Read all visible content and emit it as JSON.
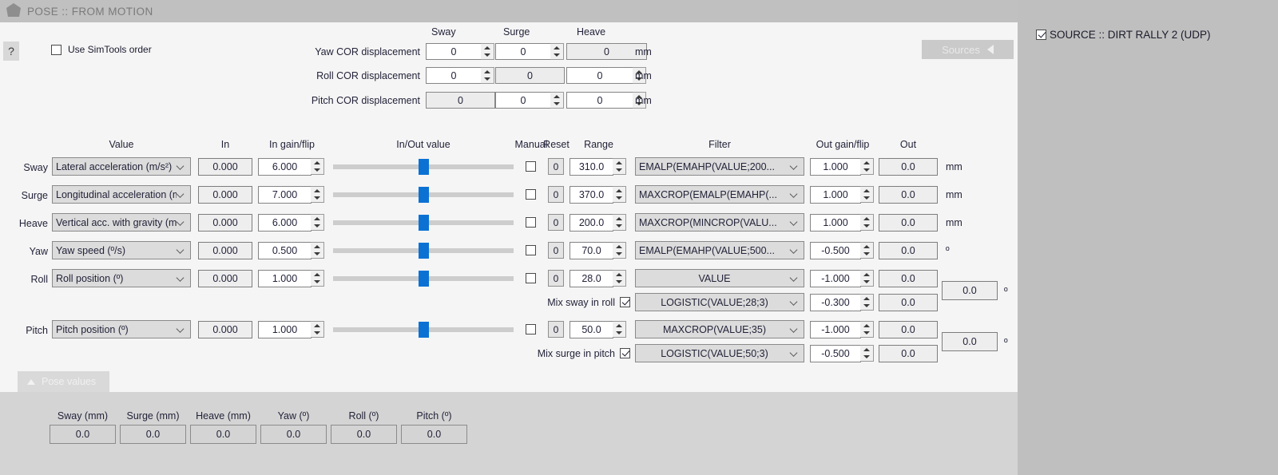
{
  "window": {
    "title": "POSE :: FROM MOTION",
    "icon": "pose-hex-icon",
    "scroll_up_arrow": "scroll-up-arrow"
  },
  "help_button": {
    "label": "?"
  },
  "options": {
    "simtools_order": {
      "label": "Use SimTools order",
      "checked": false
    }
  },
  "sources_button": {
    "label": "Sources",
    "arrow": "left-triangle"
  },
  "source_panel": {
    "checkbox_label": "SOURCE :: DIRT RALLY 2 (UDP)",
    "checked": true
  },
  "cor": {
    "headers": [
      "Sway",
      "Surge",
      "Heave"
    ],
    "unit": "mm",
    "rows": [
      {
        "label": "Yaw COR displacement",
        "sway": {
          "value": "0",
          "spinner": true,
          "disabled": false
        },
        "surge": {
          "value": "0",
          "spinner": true,
          "disabled": false
        },
        "heave": {
          "value": "0",
          "spinner": false,
          "disabled": true
        }
      },
      {
        "label": "Roll COR displacement",
        "sway": {
          "value": "0",
          "spinner": true,
          "disabled": false
        },
        "surge": {
          "value": "0",
          "spinner": false,
          "disabled": true
        },
        "heave": {
          "value": "0",
          "spinner": true,
          "disabled": false
        }
      },
      {
        "label": "Pitch COR displacement",
        "sway": {
          "value": "0",
          "spinner": false,
          "disabled": true
        },
        "surge": {
          "value": "0",
          "spinner": true,
          "disabled": false
        },
        "heave": {
          "value": "0",
          "spinner": true,
          "disabled": false
        }
      }
    ]
  },
  "grid": {
    "headers": {
      "value": "Value",
      "in": "In",
      "in_gain": "In gain/flip",
      "inout": "In/Out value",
      "manual": "Manual",
      "reset": "Reset",
      "range": "Range",
      "filter": "Filter",
      "out_gain": "Out gain/flip",
      "out": "Out"
    },
    "rows": [
      {
        "axis": "Sway",
        "value": "Lateral acceleration (m/s²)",
        "in": "0.000",
        "in_gain": "6.000",
        "slider_pct": 50,
        "manual": false,
        "reset": "0",
        "range": "310.0",
        "filter": "EMALP(EMAHP(VALUE;200...",
        "filter_center": false,
        "out_gain": "1.000",
        "out": "0.0",
        "unit": "mm"
      },
      {
        "axis": "Surge",
        "value": "Longitudinal acceleration (m",
        "in": "0.000",
        "in_gain": "7.000",
        "slider_pct": 50,
        "manual": false,
        "reset": "0",
        "range": "370.0",
        "filter": "MAXCROP(EMALP(EMAHP(...",
        "filter_center": false,
        "out_gain": "1.000",
        "out": "0.0",
        "unit": "mm"
      },
      {
        "axis": "Heave",
        "value": "Vertical acc. with gravity (m",
        "in": "0.000",
        "in_gain": "6.000",
        "slider_pct": 50,
        "manual": false,
        "reset": "0",
        "range": "200.0",
        "filter": "MAXCROP(MINCROP(VALU...",
        "filter_center": false,
        "out_gain": "1.000",
        "out": "0.0",
        "unit": "mm"
      },
      {
        "axis": "Yaw",
        "value": "Yaw speed (º/s)",
        "in": "0.000",
        "in_gain": "0.500",
        "slider_pct": 50,
        "manual": false,
        "reset": "0",
        "range": "70.0",
        "filter": "EMALP(EMAHP(VALUE;500...",
        "filter_center": false,
        "out_gain": "-0.500",
        "out": "0.0",
        "unit": "º"
      },
      {
        "axis": "Roll",
        "value": "Roll position (º)",
        "in": "0.000",
        "in_gain": "1.000",
        "slider_pct": 50,
        "manual": false,
        "reset": "0",
        "range": "28.0",
        "filter": "VALUE",
        "filter_center": true,
        "out_gain": "-1.000",
        "out": "0.0",
        "total": "0.0",
        "unit": "º"
      },
      {
        "axis": "Pitch",
        "value": "Pitch position (º)",
        "in": "0.000",
        "in_gain": "1.000",
        "slider_pct": 50,
        "manual": false,
        "reset": "0",
        "range": "50.0",
        "filter": "MAXCROP(VALUE;35)",
        "filter_center": true,
        "out_gain": "-1.000",
        "out": "0.0",
        "total": "0.0",
        "unit": "º"
      }
    ],
    "mix_rows": [
      {
        "label": "Mix sway in roll",
        "checked": true,
        "filter": "LOGISTIC(VALUE;28;3)",
        "out_gain": "-0.300",
        "out": "0.0"
      },
      {
        "label": "Mix surge in pitch",
        "checked": true,
        "filter": "LOGISTIC(VALUE;50;3)",
        "out_gain": "-0.500",
        "out": "0.0"
      }
    ]
  },
  "pose_values": {
    "tab_label": "Pose values",
    "columns": [
      {
        "label": "Sway (mm)",
        "value": "0.0"
      },
      {
        "label": "Surge (mm)",
        "value": "0.0"
      },
      {
        "label": "Heave (mm)",
        "value": "0.0"
      },
      {
        "label": "Yaw (º)",
        "value": "0.0"
      },
      {
        "label": "Roll (º)",
        "value": "0.0"
      },
      {
        "label": "Pitch (º)",
        "value": "0.0"
      }
    ]
  },
  "colors": {
    "accent": "#0b72d4",
    "panel_bg": "#f5f5f5",
    "titlebar_bg": "#c0c0c0",
    "outer_bg": "#bfbfbf",
    "combo_bg": "#dcdcdc"
  }
}
